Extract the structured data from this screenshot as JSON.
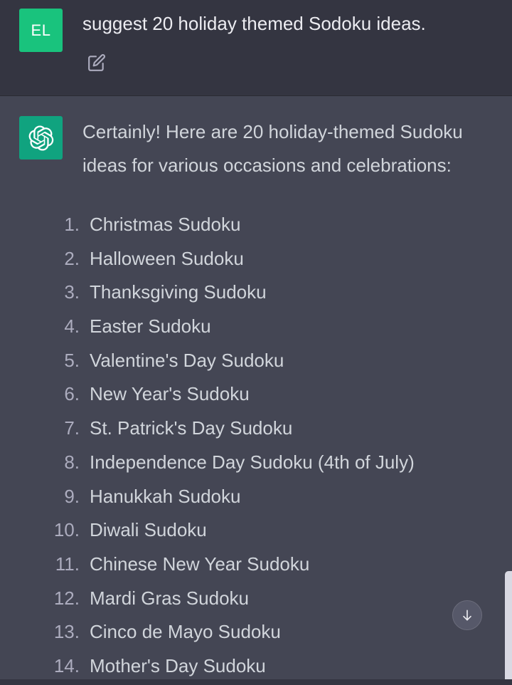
{
  "user_message": {
    "avatar_initials": "EL",
    "avatar_color": "#19c37d",
    "text": "suggest 20 holiday themed Sodoku ideas.",
    "edit_icon": "edit-icon"
  },
  "assistant_message": {
    "avatar_icon": "openai-logo-icon",
    "avatar_color": "#10a37f",
    "intro_line1": "Certainly! Here are 20 holiday-themed Sudoku",
    "intro_line2": "ideas for various occasions and celebrations:",
    "items": [
      {
        "num": "1.",
        "text": "Christmas Sudoku"
      },
      {
        "num": "2.",
        "text": "Halloween Sudoku"
      },
      {
        "num": "3.",
        "text": "Thanksgiving Sudoku"
      },
      {
        "num": "4.",
        "text": "Easter Sudoku"
      },
      {
        "num": "5.",
        "text": "Valentine's Day Sudoku"
      },
      {
        "num": "6.",
        "text": "New Year's Sudoku"
      },
      {
        "num": "7.",
        "text": "St. Patrick's Day Sudoku"
      },
      {
        "num": "8.",
        "text": "Independence Day Sudoku (4th of July)"
      },
      {
        "num": "9.",
        "text": "Hanukkah Sudoku"
      },
      {
        "num": "10.",
        "text": "Diwali Sudoku"
      },
      {
        "num": "11.",
        "text": "Chinese New Year Sudoku"
      },
      {
        "num": "12.",
        "text": "Mardi Gras Sudoku"
      },
      {
        "num": "13.",
        "text": "Cinco de Mayo Sudoku"
      },
      {
        "num": "14.",
        "text": "Mother's Day Sudoku"
      }
    ]
  },
  "controls": {
    "scroll_down_icon": "arrow-down-icon"
  },
  "colors": {
    "user_bg": "#343541",
    "assistant_bg": "#444654",
    "text": "#d1d5db"
  }
}
